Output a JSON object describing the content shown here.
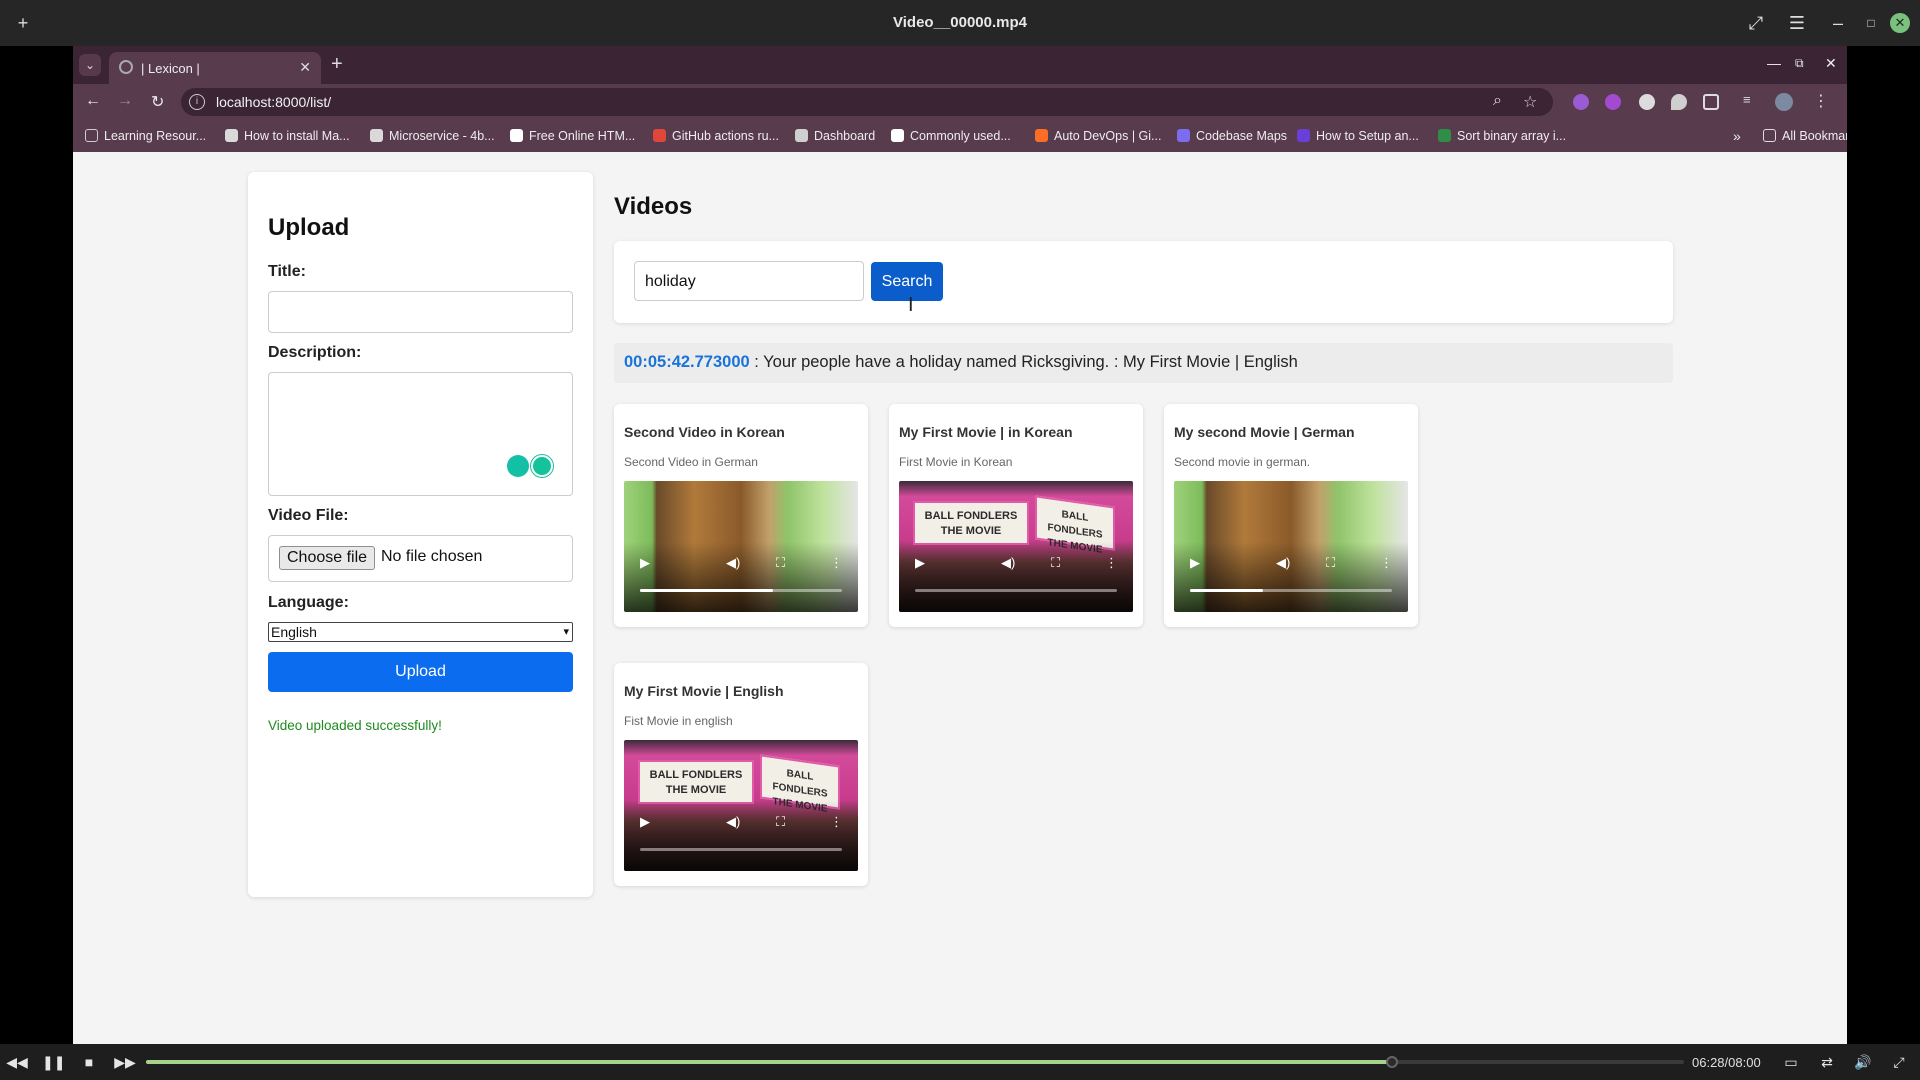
{
  "player": {
    "title": "Video__00000.mp4",
    "time": "06:28/08:00",
    "progress": 0.81
  },
  "browser": {
    "tab_title": "| Lexicon |",
    "url": "localhost:8000/list/",
    "bookmarks": [
      {
        "label": "Learning Resour...",
        "icon": "folder-icon",
        "color": "#cfcfcf"
      },
      {
        "label": "How to install Ma...",
        "icon": "site-icon",
        "color": "#d9d9d9"
      },
      {
        "label": "Microservice - 4b...",
        "icon": "site-icon",
        "color": "#d9d9d9"
      },
      {
        "label": "Free Online HTM...",
        "icon": "ff-icon",
        "color": "#ffffff"
      },
      {
        "label": "GitHub actions ru...",
        "icon": "site-icon",
        "color": "#e0463a"
      },
      {
        "label": "Dashboard",
        "icon": "globe-icon",
        "color": "#cfcfcf"
      },
      {
        "label": "Commonly used...",
        "icon": "site-icon",
        "color": "#ffffff"
      },
      {
        "label": "Auto DevOps | Gi...",
        "icon": "gitlab-icon",
        "color": "#fc6d26"
      },
      {
        "label": "Codebase Maps",
        "icon": "site-icon",
        "color": "#7c6cf0"
      },
      {
        "label": "How to Setup an...",
        "icon": "site-icon",
        "color": "#6a3fd8"
      },
      {
        "label": "Sort binary array i...",
        "icon": "site-icon",
        "color": "#2f8d46"
      }
    ],
    "all_bookmarks": "All Bookmarks"
  },
  "upload": {
    "heading": "Upload",
    "title_label": "Title:",
    "title_value": "",
    "description_label": "Description:",
    "description_value": "",
    "file_label": "Video File:",
    "file_button": "Choose file",
    "file_status": "No file chosen",
    "language_label": "Language:",
    "language_selected": "English",
    "submit": "Upload",
    "success_message": "Video uploaded successfully!"
  },
  "videos": {
    "heading": "Videos",
    "search_value": "holiday",
    "search_button": "Search",
    "result": {
      "timestamp": "00:05:42.773000",
      "text": " : Your people have a holiday named Ricksgiving. : My First Movie | English"
    },
    "items": [
      {
        "title": "Second Video in Korean",
        "description": "Second Video in German",
        "thumbnail": "cartoon",
        "progress": 0.66
      },
      {
        "title": "My First Movie | in Korean",
        "description": "First Movie in Korean",
        "thumbnail": "marquee",
        "progress": 0.0
      },
      {
        "title": "My second Movie | German",
        "description": "Second movie in german.",
        "thumbnail": "cartoon",
        "progress": 0.36
      },
      {
        "title": "My First Movie | English",
        "description": "Fist Movie in english",
        "thumbnail": "marquee",
        "progress": 0.0
      }
    ],
    "marquee_text": [
      "BALL FONDLERS",
      "THE MOVIE"
    ]
  },
  "colors": {
    "accent": "#0b6cf0",
    "browser_frame": "#583b4d",
    "success": "#1e8a1e",
    "timestamp": "#1a73d9"
  }
}
